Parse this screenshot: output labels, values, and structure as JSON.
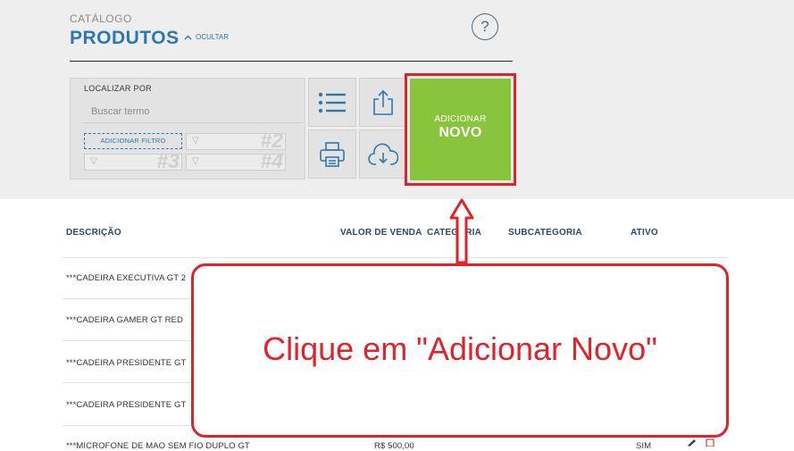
{
  "header": {
    "section": "CATÁLOGO",
    "title": "PRODUTOS",
    "hide_toggle": "OCULTAR",
    "help": "?"
  },
  "search": {
    "label": "LOCALIZAR POR",
    "placeholder": "Buscar termo",
    "add_filter": "ADICIONAR FILTRO",
    "filter_slots": [
      "#2",
      "#3",
      "#4"
    ]
  },
  "toolbar": {
    "icons": [
      "list-icon",
      "share-icon",
      "print-icon",
      "cloud-download-icon"
    ]
  },
  "add_button": {
    "line1": "ADICIONAR",
    "line2": "NOVO"
  },
  "table": {
    "columns": [
      "DESCRIÇÃO",
      "VALOR DE VENDA",
      "CATEGORIA",
      "SUBCATEGORIA",
      "ATIVO"
    ],
    "rows": [
      {
        "description": "***CADEIRA EXECUTIVA GT 2"
      },
      {
        "description": "***CADEIRA GAMER GT RED"
      },
      {
        "description": "***CADEIRA PRESIDENTE GT"
      },
      {
        "description": "***CADEIRA PRESIDENTE GT"
      },
      {
        "description": "***MICROFONE DE MAO SEM FIO DUPLO GT",
        "value": "R$ 500,00",
        "active": "SIM"
      }
    ]
  },
  "callout": {
    "text": "Clique em \"Adicionar Novo\""
  },
  "colors": {
    "accent_blue": "#2b78b3",
    "add_green": "#89c43d",
    "highlight_red": "#e0222b"
  }
}
